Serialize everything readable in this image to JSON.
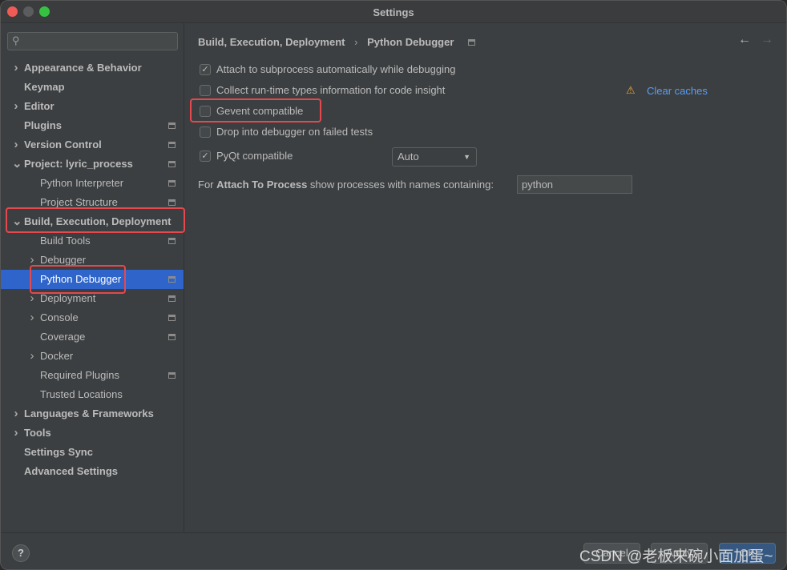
{
  "window": {
    "title": "Settings"
  },
  "search": {
    "placeholder": ""
  },
  "sidebar": {
    "items": [
      {
        "label": "Appearance & Behavior",
        "level": 0,
        "bold": true,
        "chevron": "right",
        "pin": false
      },
      {
        "label": "Keymap",
        "level": 0,
        "bold": true,
        "chevron": "",
        "pin": false
      },
      {
        "label": "Editor",
        "level": 0,
        "bold": true,
        "chevron": "right",
        "pin": false
      },
      {
        "label": "Plugins",
        "level": 0,
        "bold": true,
        "chevron": "",
        "pin": true
      },
      {
        "label": "Version Control",
        "level": 0,
        "bold": true,
        "chevron": "right",
        "pin": true
      },
      {
        "label": "Project: lyric_process",
        "level": 0,
        "bold": true,
        "chevron": "down",
        "pin": true
      },
      {
        "label": "Python Interpreter",
        "level": 1,
        "bold": false,
        "chevron": "",
        "pin": true
      },
      {
        "label": "Project Structure",
        "level": 1,
        "bold": false,
        "chevron": "",
        "pin": true
      },
      {
        "label": "Build, Execution, Deployment",
        "level": 0,
        "bold": true,
        "chevron": "down",
        "pin": false
      },
      {
        "label": "Build Tools",
        "level": 1,
        "bold": false,
        "chevron": "",
        "pin": true
      },
      {
        "label": "Debugger",
        "level": 1,
        "bold": false,
        "chevron": "right",
        "pin": false
      },
      {
        "label": "Python Debugger",
        "level": 1,
        "bold": false,
        "chevron": "",
        "pin": true,
        "selected": true
      },
      {
        "label": "Deployment",
        "level": 1,
        "bold": false,
        "chevron": "right",
        "pin": true
      },
      {
        "label": "Console",
        "level": 1,
        "bold": false,
        "chevron": "right",
        "pin": true
      },
      {
        "label": "Coverage",
        "level": 1,
        "bold": false,
        "chevron": "",
        "pin": true
      },
      {
        "label": "Docker",
        "level": 1,
        "bold": false,
        "chevron": "right",
        "pin": false
      },
      {
        "label": "Required Plugins",
        "level": 1,
        "bold": false,
        "chevron": "",
        "pin": true
      },
      {
        "label": "Trusted Locations",
        "level": 1,
        "bold": false,
        "chevron": "",
        "pin": false
      },
      {
        "label": "Languages & Frameworks",
        "level": 0,
        "bold": true,
        "chevron": "right",
        "pin": false
      },
      {
        "label": "Tools",
        "level": 0,
        "bold": true,
        "chevron": "right",
        "pin": false
      },
      {
        "label": "Settings Sync",
        "level": 0,
        "bold": true,
        "chevron": "",
        "pin": false
      },
      {
        "label": "Advanced Settings",
        "level": 0,
        "bold": true,
        "chevron": "",
        "pin": false
      }
    ]
  },
  "breadcrumb": {
    "parent": "Build, Execution, Deployment",
    "current": "Python Debugger"
  },
  "options": [
    {
      "label": "Attach to subprocess automatically while debugging",
      "checked": true
    },
    {
      "label": "Collect run-time types information for code insight",
      "checked": false
    },
    {
      "label": "Gevent compatible",
      "checked": false
    },
    {
      "label": "Drop into debugger on failed tests",
      "checked": false
    },
    {
      "label": "PyQt compatible",
      "checked": true
    }
  ],
  "pyqt_select": {
    "value": "Auto"
  },
  "clear_caches": "Clear caches",
  "attach": {
    "prefix": "For ",
    "bold": "Attach To Process",
    "suffix": " show processes with names containing:",
    "value": "python"
  },
  "footer": {
    "help": "?",
    "cancel": "Cancel",
    "apply": "Apply",
    "ok": "OK"
  },
  "watermark": "CSDN @老板来碗小面加蛋~",
  "colors": {
    "selection": "#2f65ca",
    "highlight": "#e5484d",
    "link": "#589df6"
  }
}
